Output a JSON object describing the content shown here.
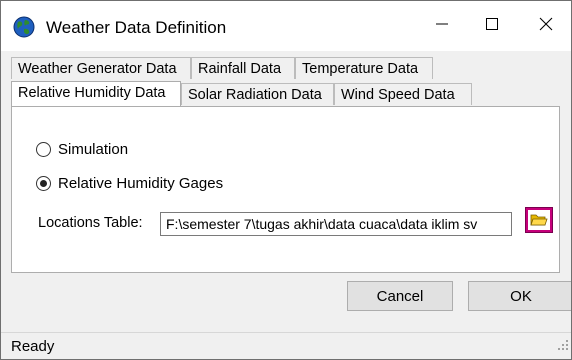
{
  "window": {
    "title": "Weather Data Definition",
    "icon": "globe-icon",
    "controls": [
      "minimize-icon",
      "maximize-icon",
      "close-icon"
    ]
  },
  "tabs": {
    "row1": [
      "Weather Generator Data",
      "Rainfall Data",
      "Temperature Data"
    ],
    "row2": [
      "Relative Humidity Data",
      "Solar Radiation Data",
      "Wind Speed Data"
    ],
    "active": "Relative Humidity Data"
  },
  "options": {
    "simulation_label": "Simulation",
    "gages_label": "Relative Humidity Gages",
    "selected": "Relative Humidity Gages"
  },
  "locations": {
    "label": "Locations Table:",
    "value": "F:\\semester 7\\tugas akhir\\data cuaca\\data iklim sv",
    "browse_icon": "folder-open-icon"
  },
  "buttons": {
    "cancel": "Cancel",
    "ok": "OK"
  },
  "status": {
    "text": "Ready"
  },
  "colors": {
    "browse_button": "#c5007a",
    "panel_background": "#ffffff",
    "window_background": "#f0f0f0"
  }
}
